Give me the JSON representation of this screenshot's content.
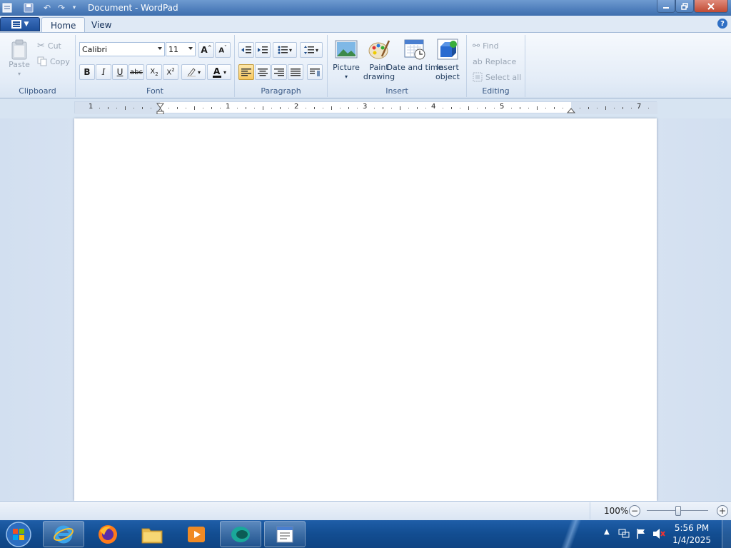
{
  "window": {
    "title": "Document - WordPad"
  },
  "quick_access": [
    "save-icon",
    "undo-icon",
    "redo-icon",
    "customize-icon"
  ],
  "tabs": [
    {
      "label": "Home",
      "active": true
    },
    {
      "label": "View",
      "active": false
    }
  ],
  "clipboard": {
    "group": "Clipboard",
    "paste": "Paste",
    "cut": "Cut",
    "copy": "Copy"
  },
  "font": {
    "group": "Font",
    "family": "Calibri",
    "size": "11"
  },
  "paragraph": {
    "group": "Paragraph"
  },
  "insert": {
    "group": "Insert",
    "picture": "Picture",
    "paint": "Paint drawing",
    "datetime": "Date and time",
    "object": "Insert object"
  },
  "editing": {
    "group": "Editing",
    "find": "Find",
    "replace": "Replace",
    "select_all": "Select all"
  },
  "ruler": {
    "numbers": [
      "1",
      "1",
      "2",
      "3",
      "4",
      "5",
      "7"
    ]
  },
  "status": {
    "zoom": "100%"
  },
  "taskbar": {
    "apps": [
      "internet-explorer-icon",
      "firefox-icon",
      "file-explorer-icon",
      "media-player-icon",
      "app-icon",
      "wordpad-icon"
    ]
  },
  "clock": {
    "time": "5:56 PM",
    "date": "1/4/2025"
  },
  "colors": {
    "accent": "#2f5f9f",
    "selected_button": "#f8c75e",
    "taskbar": "#124d91"
  }
}
